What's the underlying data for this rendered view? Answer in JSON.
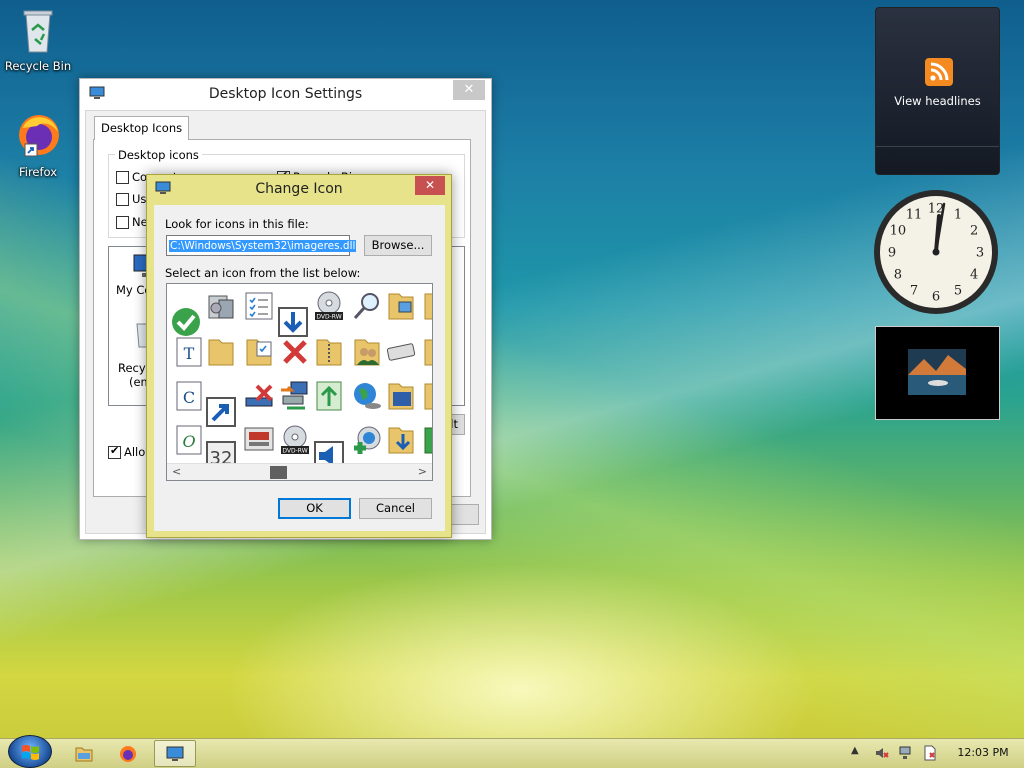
{
  "desktop": {
    "icons": [
      {
        "label": "Recycle Bin",
        "icon": "recycle-bin-icon"
      },
      {
        "label": "Firefox",
        "icon": "firefox-icon"
      }
    ]
  },
  "desktop_icon_settings": {
    "title": "Desktop Icon Settings",
    "tab": "Desktop Icons",
    "group_label": "Desktop icons",
    "checkboxes": [
      {
        "label": "Computer",
        "checked": false
      },
      {
        "label": "Recycle Bin",
        "checked": true
      },
      {
        "label": "Use",
        "checked": false
      },
      {
        "label": "Ne",
        "checked": false
      }
    ],
    "preview_labels": [
      "My Co",
      "Recyc",
      "(emp"
    ],
    "allow_label": "Allow",
    "restore_fragment": "lt"
  },
  "change_icon": {
    "title": "Change Icon",
    "look_label": "Look for icons in this file:",
    "file_path": "C:\\Windows\\System32\\imageres.dll",
    "browse_button": "Browse...",
    "list_label": "Select an icon from the list below:",
    "ok_button": "OK",
    "cancel_button": "Cancel"
  },
  "gadgets": {
    "feed_label": "View headlines",
    "clock_numbers": [
      "12",
      "1",
      "2",
      "3",
      "4",
      "5",
      "6",
      "7",
      "8",
      "9",
      "10",
      "11"
    ]
  },
  "taskbar": {
    "clock": "12:03 PM"
  },
  "colors": {
    "accent_selection": "#3399ff",
    "close_red": "#c75050",
    "dialog_frame": "#e6e38a"
  }
}
